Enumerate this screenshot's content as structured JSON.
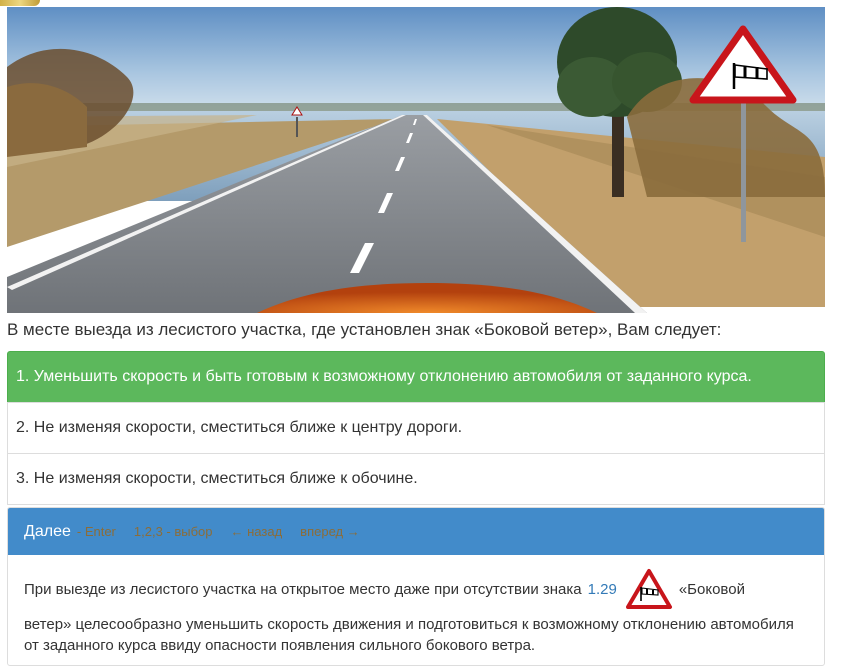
{
  "question": {
    "text": "В месте выезда из лесистого участка, где установлен знак «Боковой ветер», Вам следует:"
  },
  "answers": [
    {
      "text": "1. Уменьшить скорость и быть готовым к возможному отклонению автомобиля от заданного курса.",
      "correct": true
    },
    {
      "text": "2. Не изменяя скорости, сместиться ближе к центру дороги.",
      "correct": false
    },
    {
      "text": "3. Не изменяя скорости, сместиться ближе к обочине.",
      "correct": false
    }
  ],
  "toolbar": {
    "next_label": "Далее",
    "enter_hint": "- Enter",
    "select_hint": "1,2,3 - выбор",
    "back_label": "← назад",
    "forward_label": "вперед →"
  },
  "explanation": {
    "part1": "При выезде из лесистого участка на открытое место даже при отсутствии знака",
    "sign_ref": "1.29",
    "part2": "«Боковой",
    "part3": "ветер» целесообразно уменьшить скорость движения и подготовиться к возможному отклонению автомобиля от заданного курса ввиду опасности появления сильного бокового ветра."
  },
  "icons": {
    "road_sign": "crosswind-warning-sign-icon"
  },
  "colors": {
    "correct": "#5cb85c",
    "panel_heading": "#428bca",
    "link": "#337ab7",
    "hint": "#8a6d3b"
  }
}
